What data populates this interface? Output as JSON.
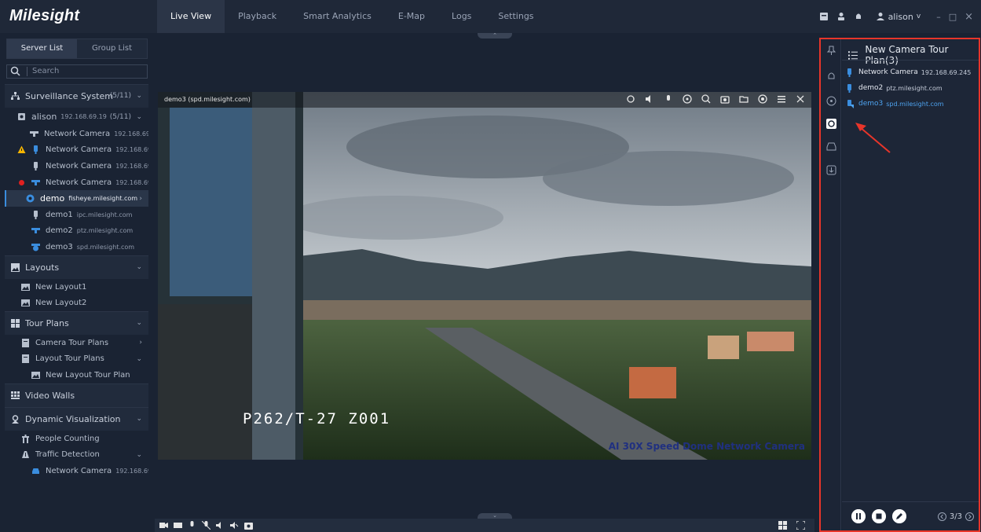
{
  "app": {
    "brand": "Milesight"
  },
  "nav": {
    "items": [
      "Live View",
      "Playback",
      "Smart Analytics",
      "E-Map",
      "Logs",
      "Settings"
    ],
    "active": "Live View"
  },
  "user": {
    "name": "alison",
    "caret": "v",
    "min": "–",
    "restore": "□",
    "close": "×"
  },
  "left": {
    "tabs": [
      "Server List",
      "Group List"
    ],
    "search_placeholder": "Search",
    "surveillance": {
      "label": "Surveillance System",
      "count": "(5/11)"
    },
    "server": {
      "name": "alison",
      "ip": "192.168.69.19",
      "count": "(5/11)"
    },
    "devices": [
      {
        "name": "Network Camera",
        "ip": "192.168.69..."
      },
      {
        "name": "Network Camera",
        "ip": "192.168.69..."
      },
      {
        "name": "Network Camera",
        "ip": "192.168.69..."
      },
      {
        "name": "Network Camera",
        "ip": "192.168.69..."
      },
      {
        "name": "demo",
        "ip": "fisheye.milesight.com"
      },
      {
        "name": "demo1",
        "ip": "ipc.milesight.com"
      },
      {
        "name": "demo2",
        "ip": "ptz.milesight.com"
      },
      {
        "name": "demo3",
        "ip": "spd.milesight.com"
      }
    ],
    "layouts": {
      "label": "Layouts",
      "items": [
        "New Layout1",
        "New Layout2"
      ]
    },
    "tour_plans": {
      "label": "Tour Plans",
      "camera": "Camera Tour Plans",
      "layout": "Layout Tour Plans",
      "layout_item": "New Layout Tour Plan"
    },
    "video_walls": "Video Walls",
    "dynamic": {
      "label": "Dynamic Visualization",
      "people": "People Counting",
      "traffic": "Traffic Detection",
      "traffic_cam": {
        "name": "Network Camera",
        "ip": "192.168.69..."
      }
    }
  },
  "video": {
    "title": "demo3 (spd.milesight.com)",
    "osd_ptz": "P262/T-27   Z001",
    "osd_name": "AI 30X Speed Dome Network Camera"
  },
  "right": {
    "title": "New Camera Tour Plan(3)",
    "items": [
      {
        "name": "Network Camera",
        "ip": "192.168.69.245"
      },
      {
        "name": "demo2",
        "ip": "ptz.milesight.com"
      },
      {
        "name": "demo3",
        "ip": "spd.milesight.com"
      }
    ],
    "pager": "3/3"
  },
  "colors": {
    "accent": "#3a8dde",
    "highlight_box": "#e8352a",
    "selected_item": "#4ea3f0",
    "warning": "#f5b400",
    "alarm": "#e02020"
  }
}
